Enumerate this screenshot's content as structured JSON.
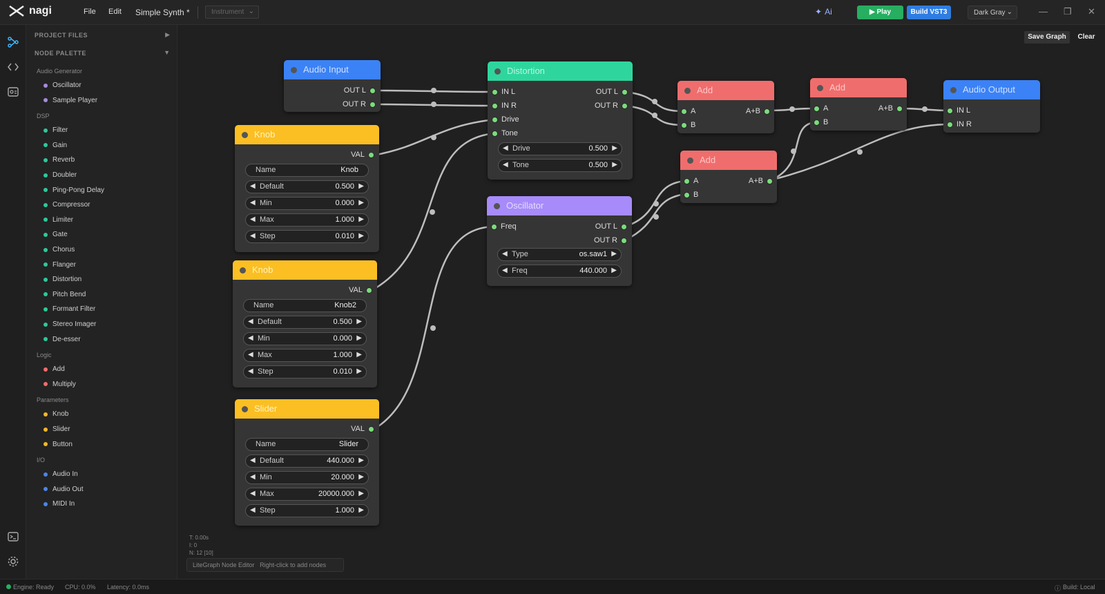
{
  "app": {
    "name": "nagi"
  },
  "menu": {
    "file": "File",
    "edit": "Edit"
  },
  "project": {
    "title": "Simple Synth *",
    "type_select": "Instrument"
  },
  "toolbar": {
    "ai_label": "Ai",
    "play_label": "Play",
    "build_label": "Build VST3",
    "theme": "Dark Gray"
  },
  "canvas_actions": {
    "save": "Save Graph",
    "clear": "Clear"
  },
  "sidebar": {
    "project_files": "PROJECT FILES",
    "node_palette": "NODE PALETTE",
    "categories": [
      {
        "name": "Audio Generator",
        "color": "#a78bdc",
        "items": [
          "Oscillator",
          "Sample Player"
        ]
      },
      {
        "name": "DSP",
        "color": "#2ec99a",
        "items": [
          "Filter",
          "Gain",
          "Reverb",
          "Doubler",
          "Ping-Pong Delay",
          "Compressor",
          "Limiter",
          "Gate",
          "Chorus",
          "Flanger",
          "Distortion",
          "Pitch Bend",
          "Formant Filter",
          "Stereo Imager",
          "De-esser"
        ]
      },
      {
        "name": "Logic",
        "color": "#f06d6d",
        "items": [
          "Add",
          "Multiply"
        ]
      },
      {
        "name": "Parameters",
        "color": "#f5b72a",
        "items": [
          "Knob",
          "Slider",
          "Button"
        ]
      },
      {
        "name": "I/O",
        "color": "#4a86e8",
        "items": [
          "Audio In",
          "Audio Out",
          "MIDI In"
        ]
      }
    ]
  },
  "colors": {
    "io": "#3b82f6",
    "dsp": "#2ed69e",
    "logic": "#f06d6d",
    "param": "#fbbf24",
    "gen": "#a78bfa",
    "port": "#7bdc7b",
    "wire": "#bdbdbd"
  },
  "nodes": {
    "audio_input": {
      "title": "Audio Input",
      "out_l": "OUT L",
      "out_r": "OUT R"
    },
    "knob1": {
      "title": "Knob",
      "val": "VAL",
      "name_label": "Name",
      "name_value": "Knob",
      "default_label": "Default",
      "default_value": "0.500",
      "min_label": "Min",
      "min_value": "0.000",
      "max_label": "Max",
      "max_value": "1.000",
      "step_label": "Step",
      "step_value": "0.010"
    },
    "knob2": {
      "title": "Knob",
      "val": "VAL",
      "name_label": "Name",
      "name_value": "Knob2",
      "default_label": "Default",
      "default_value": "0.500",
      "min_label": "Min",
      "min_value": "0.000",
      "max_label": "Max",
      "max_value": "1.000",
      "step_label": "Step",
      "step_value": "0.010"
    },
    "slider": {
      "title": "Slider",
      "val": "VAL",
      "name_label": "Name",
      "name_value": "Slider",
      "default_label": "Default",
      "default_value": "440.000",
      "min_label": "Min",
      "min_value": "20.000",
      "max_label": "Max",
      "max_value": "20000.000",
      "step_label": "Step",
      "step_value": "1.000"
    },
    "distortion": {
      "title": "Distortion",
      "in_l": "IN L",
      "in_r": "IN R",
      "drive_in": "Drive",
      "tone_in": "Tone",
      "out_l": "OUT L",
      "out_r": "OUT R",
      "drive_label": "Drive",
      "drive_value": "0.500",
      "tone_label": "Tone",
      "tone_value": "0.500"
    },
    "oscillator": {
      "title": "Oscillator",
      "freq_in": "Freq",
      "out_l": "OUT L",
      "out_r": "OUT R",
      "type_label": "Type",
      "type_value": "os.saw1",
      "freq_label": "Freq",
      "freq_value": "440.000"
    },
    "add1": {
      "title": "Add",
      "a": "A",
      "b": "B",
      "out": "A+B"
    },
    "add2": {
      "title": "Add",
      "a": "A",
      "b": "B",
      "out": "A+B"
    },
    "add3": {
      "title": "Add",
      "a": "A",
      "b": "B",
      "out": "A+B"
    },
    "audio_output": {
      "title": "Audio Output",
      "in_l": "IN L",
      "in_r": "IN R"
    }
  },
  "canvas_info": {
    "time": "T: 0.00s",
    "i": "I: 0",
    "n": "N: 12 [10]",
    "editor": "LiteGraph Node Editor",
    "hint": "Right-click to add nodes"
  },
  "status": {
    "engine": "Engine: Ready",
    "cpu": "CPU: 0.0%",
    "latency": "Latency: 0.0ms",
    "build": "Build: Local"
  }
}
